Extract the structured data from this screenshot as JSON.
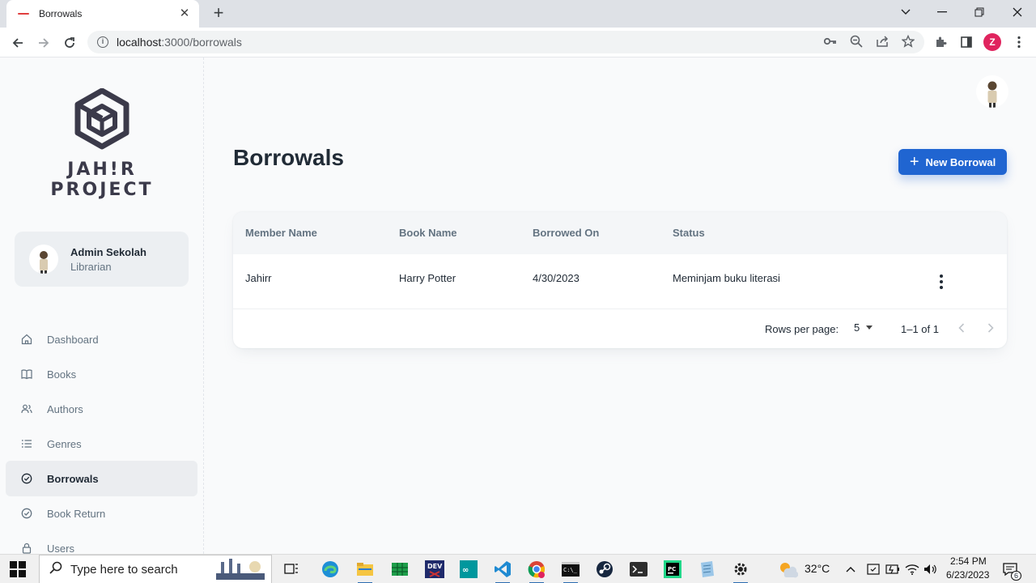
{
  "browser": {
    "tab_title": "Borrowals",
    "url_host": "localhost",
    "url_port_path": ":3000/borrowals",
    "profile_initial": "Z"
  },
  "sidebar": {
    "logo_line1": "JAH!R",
    "logo_line2": "PROJECT",
    "user_name": "Admin Sekolah",
    "user_role": "Librarian",
    "nav": [
      {
        "label": "Dashboard",
        "icon": "home-icon"
      },
      {
        "label": "Books",
        "icon": "book-icon"
      },
      {
        "label": "Authors",
        "icon": "users-icon"
      },
      {
        "label": "Genres",
        "icon": "list-icon"
      },
      {
        "label": "Borrowals",
        "icon": "check-circle-icon",
        "active": true
      },
      {
        "label": "Book Return",
        "icon": "check-circle-icon"
      },
      {
        "label": "Users",
        "icon": "lock-icon"
      }
    ]
  },
  "main": {
    "title": "Borrowals",
    "new_button_label": "New Borrowal",
    "columns": [
      "Member Name",
      "Book Name",
      "Borrowed On",
      "Status"
    ],
    "rows": [
      {
        "member": "Jahirr",
        "book": "Harry Potter",
        "borrowed_on": "4/30/2023",
        "status": "Meminjam buku literasi"
      }
    ],
    "pagination": {
      "rows_per_page_label": "Rows per page:",
      "rows_per_page_value": "5",
      "range": "1–1 of 1"
    }
  },
  "taskbar": {
    "search_placeholder": "Type here to search",
    "temperature": "32°C",
    "time": "2:54 PM",
    "date": "6/23/2023",
    "notification_count": "6"
  },
  "colors": {
    "primary": "#2065d1",
    "text": "#212b36",
    "muted": "#637381",
    "background": "#f9fafb"
  }
}
